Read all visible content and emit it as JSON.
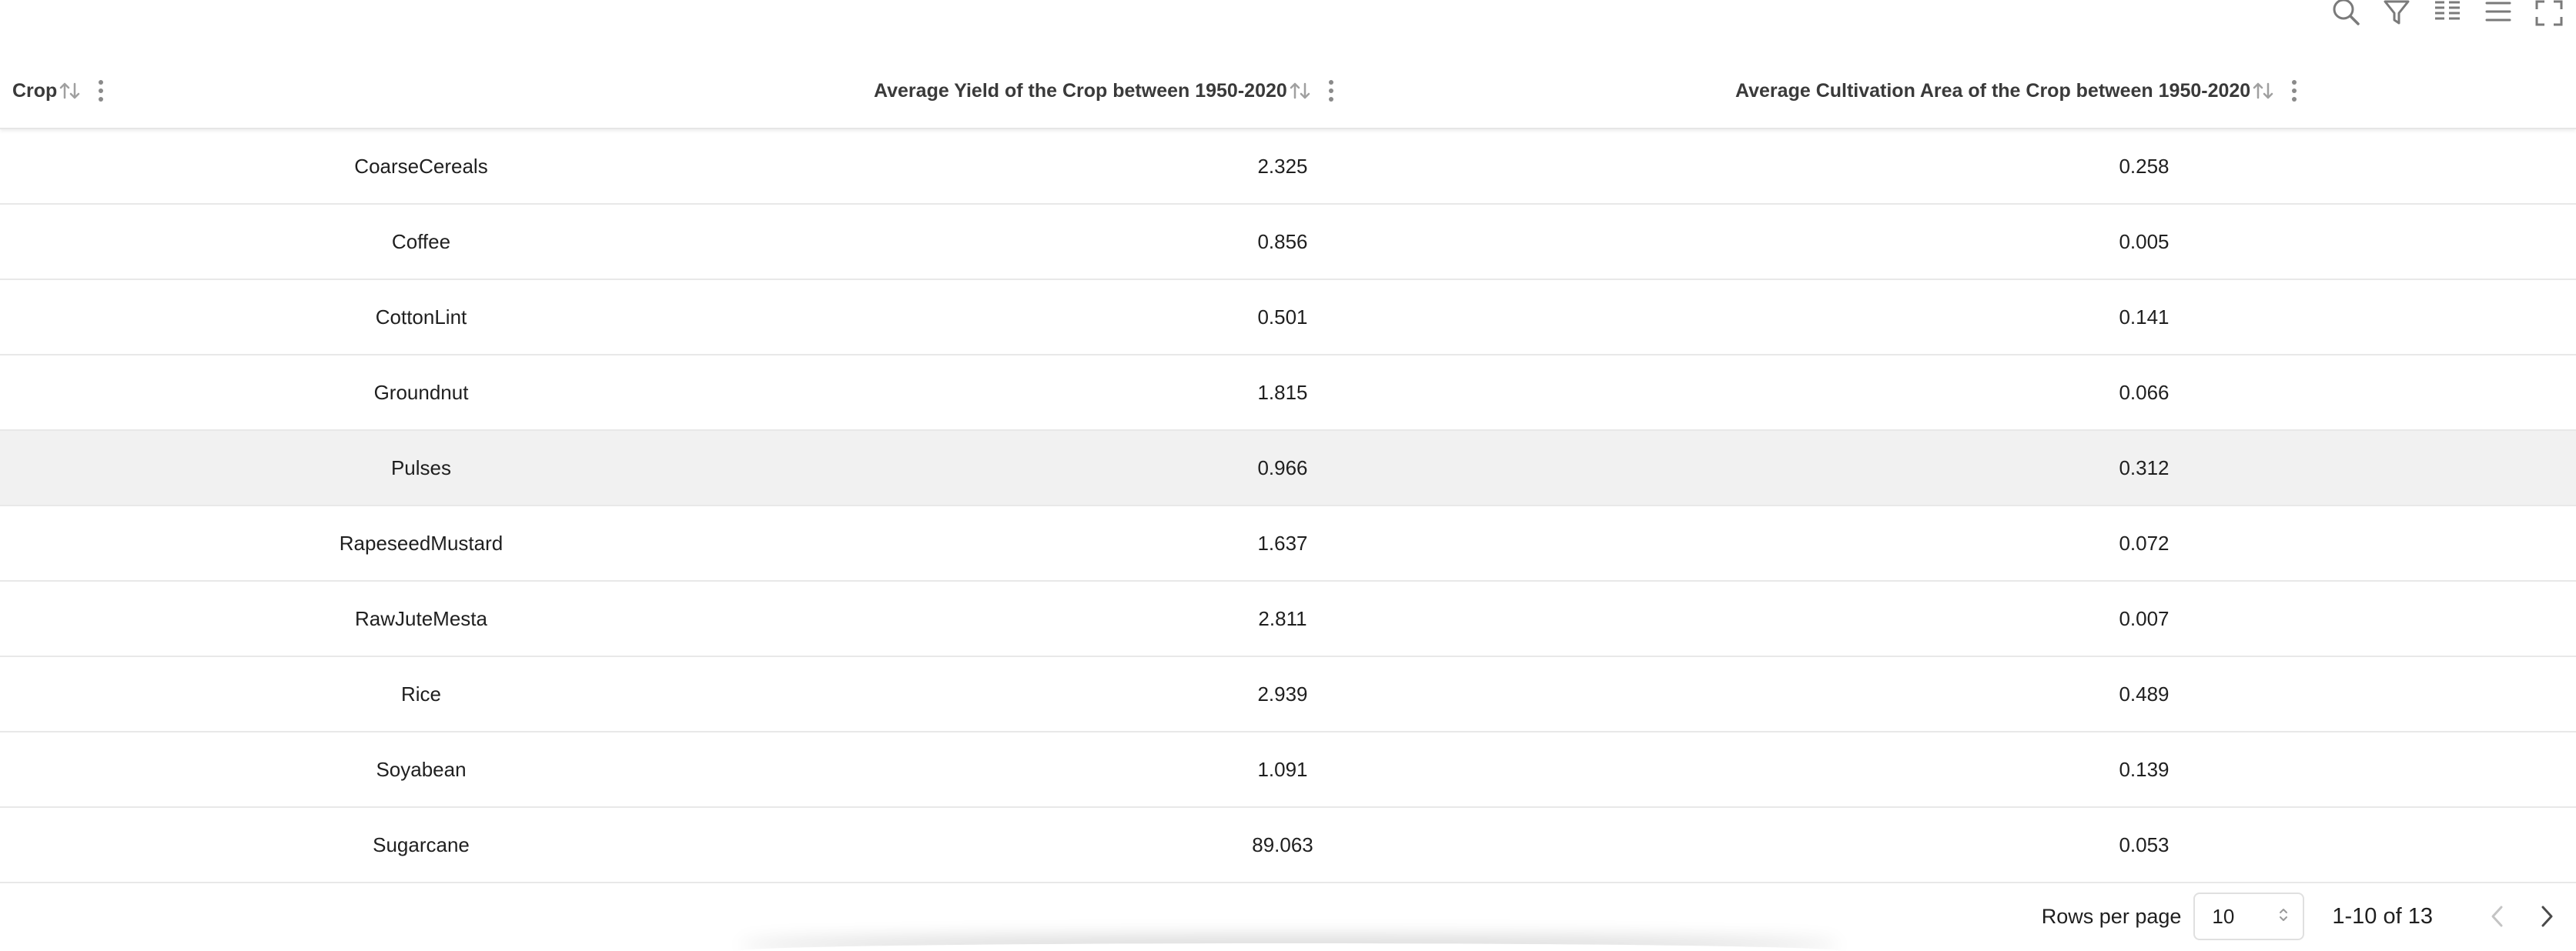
{
  "toolbar": {
    "icons": [
      "search-icon",
      "filter-icon",
      "columns-icon",
      "density-icon",
      "fullscreen-icon"
    ]
  },
  "table": {
    "headers": {
      "crop": "Crop",
      "yield": "Average Yield of the Crop between 1950-2020",
      "area": "Average Cultivation Area of the Crop between 1950-2020"
    },
    "rows": [
      {
        "crop": "CoarseCereals",
        "yield": "2.325",
        "area": "0.258"
      },
      {
        "crop": "Coffee",
        "yield": "0.856",
        "area": "0.005"
      },
      {
        "crop": "CottonLint",
        "yield": "0.501",
        "area": "0.141"
      },
      {
        "crop": "Groundnut",
        "yield": "1.815",
        "area": "0.066"
      },
      {
        "crop": "Pulses",
        "yield": "0.966",
        "area": "0.312"
      },
      {
        "crop": "RapeseedMustard",
        "yield": "1.637",
        "area": "0.072"
      },
      {
        "crop": "RawJuteMesta",
        "yield": "2.811",
        "area": "0.007"
      },
      {
        "crop": "Rice",
        "yield": "2.939",
        "area": "0.489"
      },
      {
        "crop": "Soyabean",
        "yield": "1.091",
        "area": "0.139"
      },
      {
        "crop": "Sugarcane",
        "yield": "89.063",
        "area": "0.053"
      }
    ],
    "highlighted_row": 4
  },
  "pagination": {
    "rows_per_page_label": "Rows per page",
    "rows_per_page_value": "10",
    "range": "1-10 of 13"
  }
}
